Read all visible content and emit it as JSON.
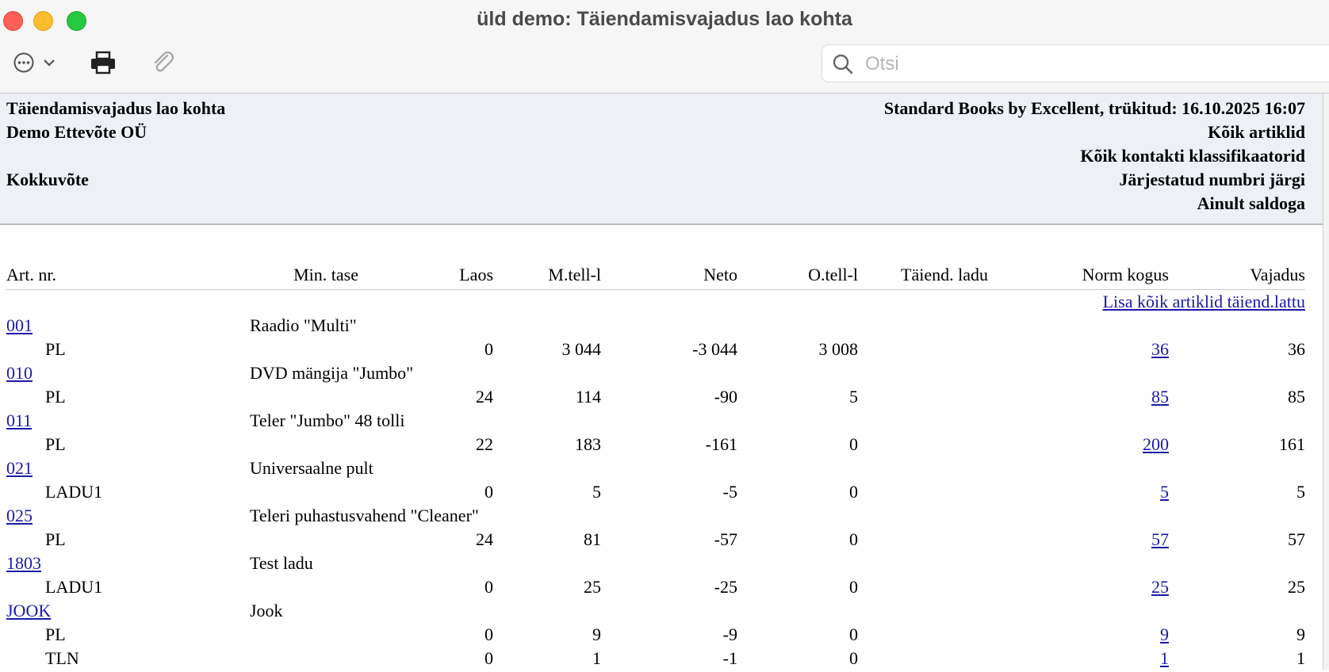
{
  "window": {
    "title": "üld demo: Täiendamisvajadus lao kohta",
    "search_placeholder": "Otsi"
  },
  "toolbar": {
    "more_icon": "ellipsis-circle-icon",
    "chevron_icon": "chevron-down-icon",
    "print_icon": "printer-icon",
    "attach_icon": "paperclip-icon",
    "search_icon": "magnifier-icon"
  },
  "header": {
    "report_title": "Täiendamisvajadus lao kohta",
    "company": "Demo Ettevõte OÜ",
    "summary": "Kokkuvõte",
    "printed_by": "Standard Books by Excellent, trükitud: 16.10.2025 16:07",
    "filter_articles": "Kõik artiklid",
    "filter_contacts": "Kõik kontakti klassifikaatorid",
    "sort": "Järjestatud numbri järgi",
    "balance": "Ainult saldoga"
  },
  "columns": {
    "art_nr": "Art. nr.",
    "min_tase": "Min. tase",
    "laos": "Laos",
    "m_tell": "M.tell-l",
    "neto": "Neto",
    "o_tell": "O.tell-l",
    "taiend_ladu": "Täiend. ladu",
    "norm_kogus": "Norm kogus",
    "vajadus": "Vajadus"
  },
  "add_all_link": "Lisa kõik artiklid täiend.lattu",
  "rows": [
    {
      "type": "article",
      "code": "001",
      "name": "Raadio \"Multi\""
    },
    {
      "type": "stock",
      "warehouse": "PL",
      "laos": "0",
      "m_tell": "3 044",
      "neto": "-3 044",
      "o_tell": "3 008",
      "norm": "36",
      "vajadus": "36"
    },
    {
      "type": "article",
      "code": "010",
      "name": "DVD mängija \"Jumbo\""
    },
    {
      "type": "stock",
      "warehouse": "PL",
      "laos": "24",
      "m_tell": "114",
      "neto": "-90",
      "o_tell": "5",
      "norm": "85",
      "vajadus": "85"
    },
    {
      "type": "article",
      "code": "011",
      "name": "Teler \"Jumbo\" 48 tolli"
    },
    {
      "type": "stock",
      "warehouse": "PL",
      "laos": "22",
      "m_tell": "183",
      "neto": "-161",
      "o_tell": "0",
      "norm": "200",
      "vajadus": "161"
    },
    {
      "type": "article",
      "code": "021",
      "name": "Universaalne pult"
    },
    {
      "type": "stock",
      "warehouse": "LADU1",
      "laos": "0",
      "m_tell": "5",
      "neto": "-5",
      "o_tell": "0",
      "norm": "5",
      "vajadus": "5"
    },
    {
      "type": "article",
      "code": "025",
      "name": "Teleri puhastusvahend \"Cleaner\""
    },
    {
      "type": "stock",
      "warehouse": "PL",
      "laos": "24",
      "m_tell": "81",
      "neto": "-57",
      "o_tell": "0",
      "norm": "57",
      "vajadus": "57"
    },
    {
      "type": "article",
      "code": "1803",
      "name": "Test ladu"
    },
    {
      "type": "stock",
      "warehouse": "LADU1",
      "laos": "0",
      "m_tell": "25",
      "neto": "-25",
      "o_tell": "0",
      "norm": "25",
      "vajadus": "25"
    },
    {
      "type": "article",
      "code": "JOOK",
      "name": "Jook"
    },
    {
      "type": "stock",
      "warehouse": "PL",
      "laos": "0",
      "m_tell": "9",
      "neto": "-9",
      "o_tell": "0",
      "norm": "9",
      "vajadus": "9"
    },
    {
      "type": "stock",
      "warehouse": "TLN",
      "laos": "0",
      "m_tell": "1",
      "neto": "-1",
      "o_tell": "0",
      "norm": "1",
      "vajadus": "1"
    }
  ]
}
